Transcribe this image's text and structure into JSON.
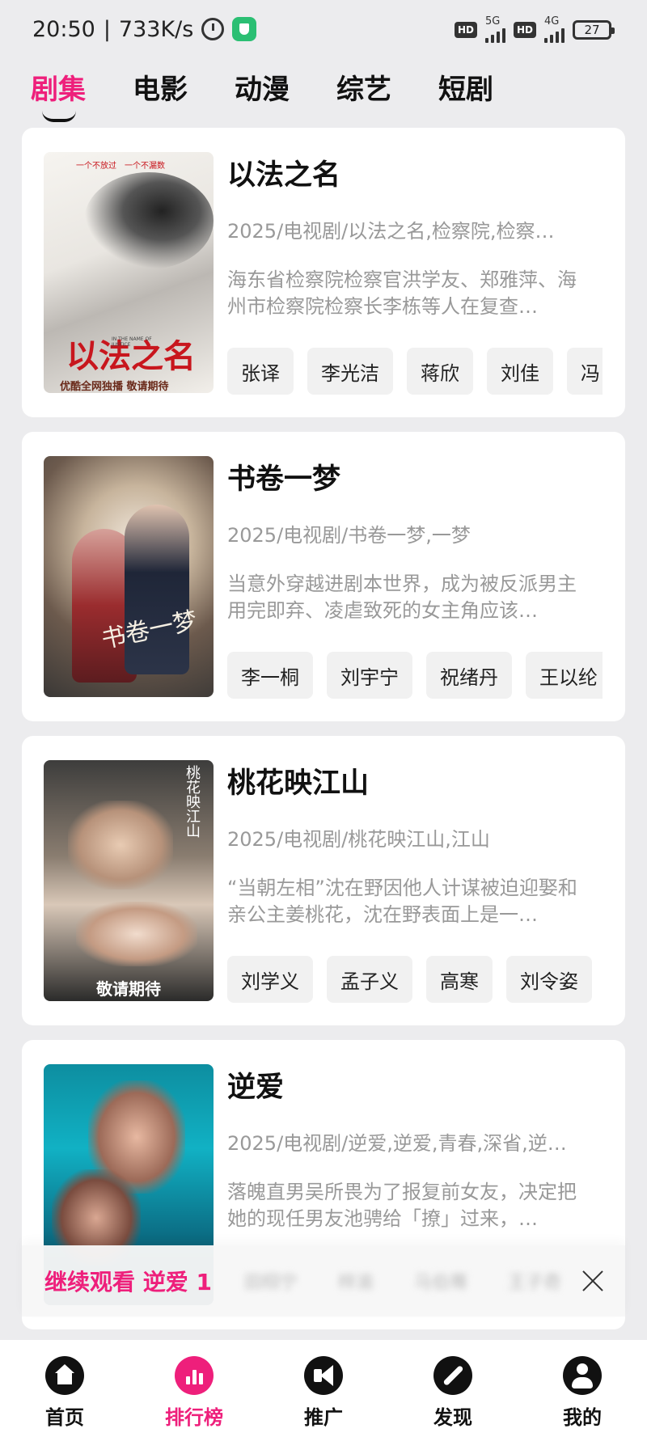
{
  "status_bar": {
    "time": "20:50",
    "net_speed": "733K/s",
    "net1": "5G",
    "net2": "4G",
    "hd_label": "HD",
    "battery": "27"
  },
  "tabs": [
    {
      "label": "剧集",
      "active": true
    },
    {
      "label": "电影",
      "active": false
    },
    {
      "label": "动漫",
      "active": false
    },
    {
      "label": "综艺",
      "active": false
    },
    {
      "label": "短剧",
      "active": false
    }
  ],
  "cards": [
    {
      "title": "以法之名",
      "meta": "2025/电视剧/以法之名,检察院,检察…",
      "desc": "海东省检察院检察官洪学友、郑雅萍、海州市检察院检察长李栋等人在复查…",
      "tags": [
        "张译",
        "李光洁",
        "蒋欣",
        "刘佳",
        "冯"
      ],
      "poster": {
        "top_text": "一个不放过　一个不漏数",
        "title_art": "以法之名",
        "eng": "IN THE NAME OF JUSTICE",
        "bottom": "优酷全网独播 敬请期待"
      }
    },
    {
      "title": "书卷一梦",
      "meta": "2025/电视剧/书卷一梦,一梦",
      "desc": "当意外穿越进剧本世界，成为被反派男主用完即弃、凌虐致死的女主角应该…",
      "tags": [
        "李一桐",
        "刘宇宁",
        "祝绪丹",
        "王以纶"
      ],
      "poster": {
        "title_art": "书卷一梦"
      }
    },
    {
      "title": "桃花映江山",
      "meta": "2025/电视剧/桃花映江山,江山",
      "desc": "“当朝左相”沈在野因他人计谋被迫迎娶和亲公主姜桃花，沈在野表面上是一…",
      "tags": [
        "刘学义",
        "孟子义",
        "高寒",
        "刘令姿"
      ],
      "poster": {
        "title_art": "桃花映江山",
        "bottom": "敬请期待"
      }
    },
    {
      "title": "逆爱",
      "meta": "2025/电视剧/逆爱,逆爱,青春,深省,逆…",
      "desc": "落魄直男吴所畏为了报复前女友，决定把她的现任男友池骋给「撩」过来，…",
      "tags": [
        "田栩宁",
        "梓渝",
        "马伯骞",
        "王子奇"
      ],
      "poster": {}
    }
  ],
  "continue_watching": {
    "label": "继续观看 逆爱 1"
  },
  "bottom_nav": [
    {
      "label": "首页",
      "icon": "home-icon",
      "active": false
    },
    {
      "label": "排行榜",
      "icon": "rank-icon",
      "active": true
    },
    {
      "label": "推广",
      "icon": "megaphone-icon",
      "active": false
    },
    {
      "label": "发现",
      "icon": "compass-icon",
      "active": false
    },
    {
      "label": "我的",
      "icon": "profile-icon",
      "active": false
    }
  ],
  "colors": {
    "accent": "#ee1f7b",
    "background": "#ececee",
    "card": "#ffffff",
    "muted_text": "#999999"
  }
}
